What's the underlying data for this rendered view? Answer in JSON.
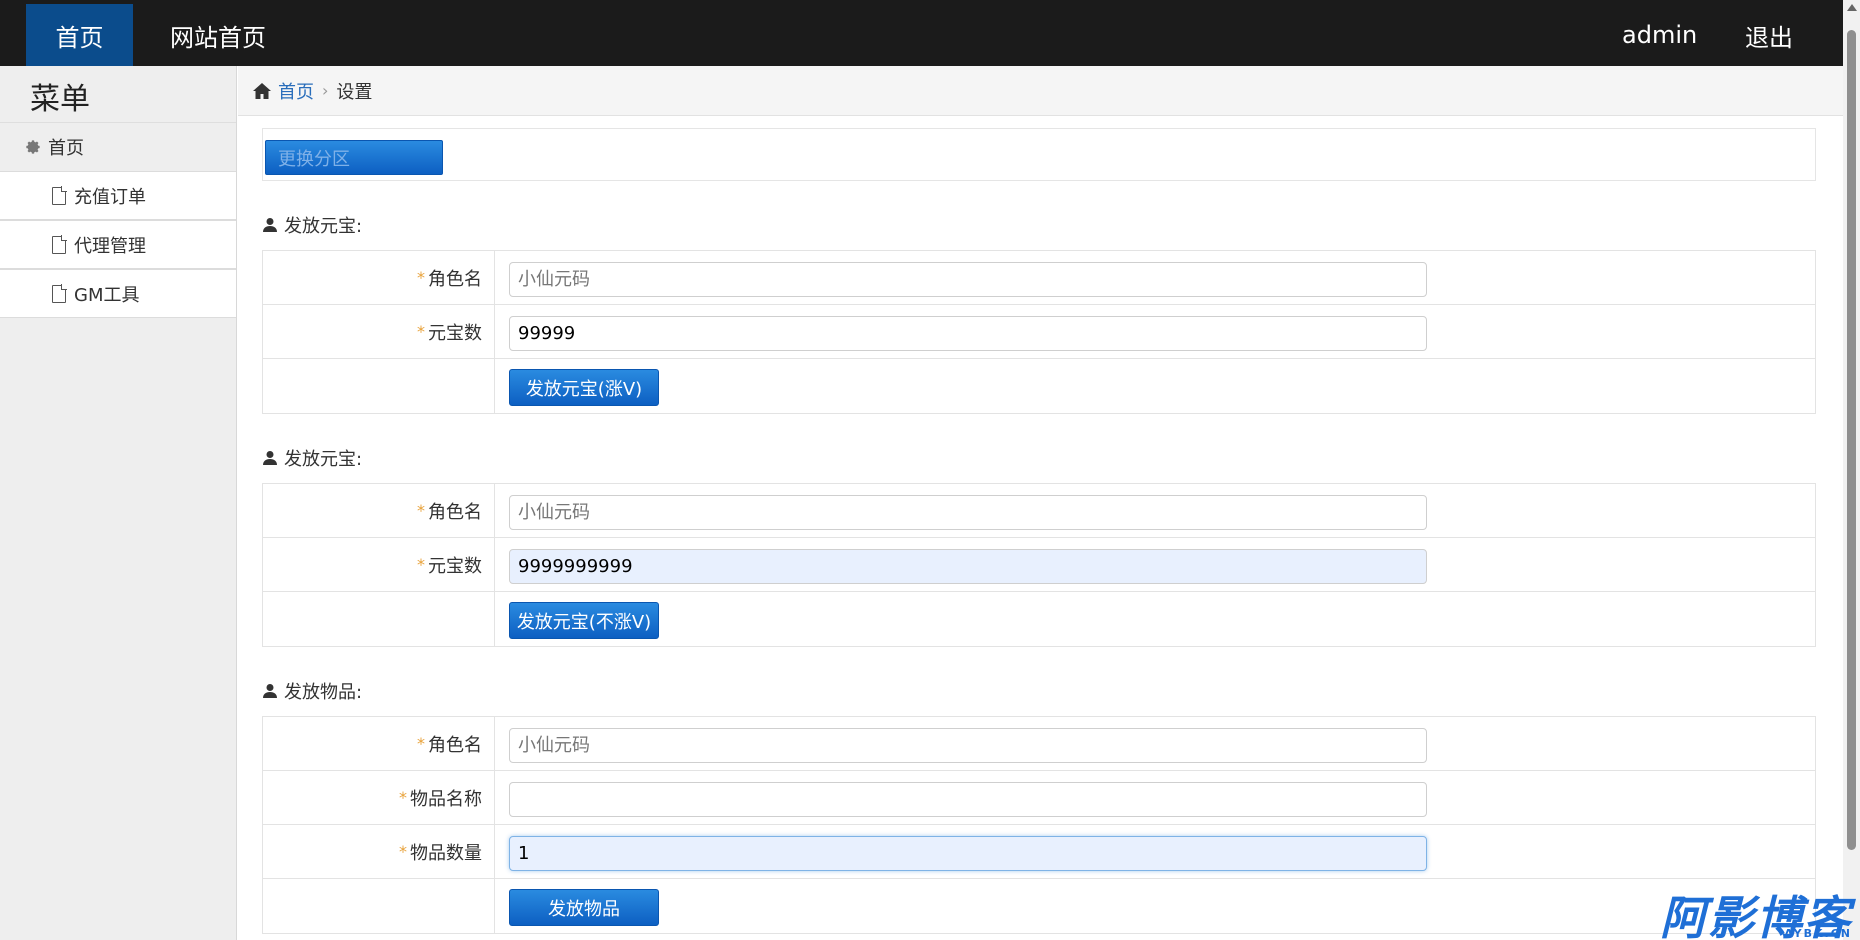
{
  "topbar": {
    "home_label": "首页",
    "site_home_label": "网站首页",
    "username": "admin",
    "logout_label": "退出"
  },
  "sidebar": {
    "title": "菜单",
    "home_label": "首页",
    "items": [
      {
        "label": "充值订单",
        "icon": "document-icon"
      },
      {
        "label": "代理管理",
        "icon": "document-icon"
      },
      {
        "label": "GM工具",
        "icon": "document-icon"
      }
    ]
  },
  "breadcrumb": {
    "home_label": "首页",
    "current_label": "设置"
  },
  "switch_panel": {
    "button_label": "更换分区"
  },
  "sections": [
    {
      "title": "发放元宝:",
      "fields": [
        {
          "label": "角色名",
          "value": "",
          "placeholder": "小仙元码"
        },
        {
          "label": "元宝数",
          "value": "99999",
          "placeholder": ""
        }
      ],
      "button_label": "发放元宝(涨V)"
    },
    {
      "title": "发放元宝:",
      "fields": [
        {
          "label": "角色名",
          "value": "",
          "placeholder": "小仙元码"
        },
        {
          "label": "元宝数",
          "value": "9999999999",
          "placeholder": ""
        }
      ],
      "button_label": "发放元宝(不涨V)"
    },
    {
      "title": "发放物品:",
      "fields": [
        {
          "label": "角色名",
          "value": "",
          "placeholder": "小仙元码"
        },
        {
          "label": "物品名称",
          "value": "",
          "placeholder": ""
        },
        {
          "label": "物品数量",
          "value": "1",
          "placeholder": ""
        }
      ],
      "button_label": "发放物品"
    }
  ],
  "watermark": {
    "text": "阿影博客",
    "subtext": "AYBK.CN"
  },
  "colors": {
    "topbar_bg": "#1b1b1b",
    "active_nav_bg": "#0b4c8c",
    "button_blue": "#0d5fc2",
    "required_star": "#e8a23a",
    "link_blue": "#2a6ebb"
  }
}
